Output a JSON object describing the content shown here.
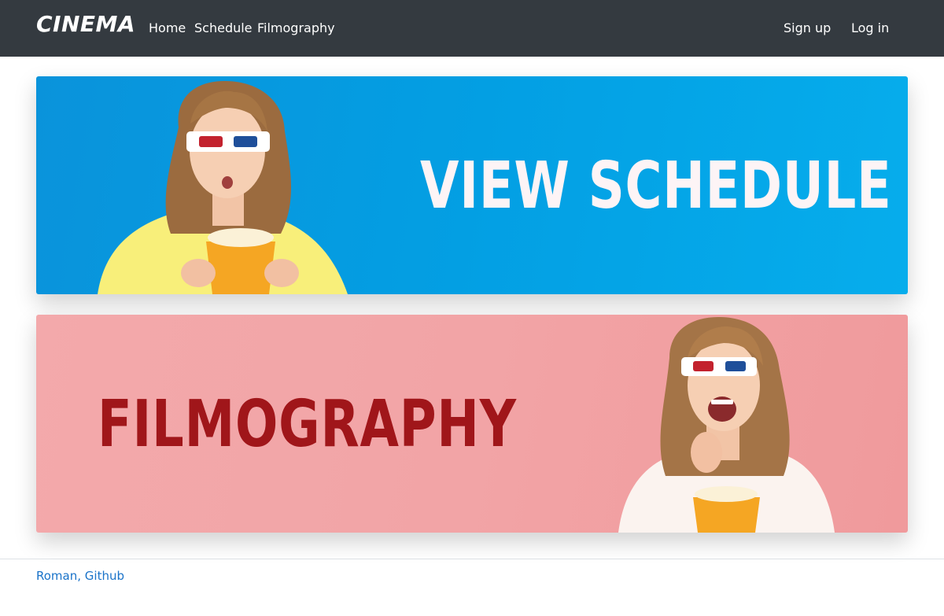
{
  "navbar": {
    "brand": "CINEMA",
    "links": [
      {
        "label": "Home"
      },
      {
        "label": "Schedule"
      },
      {
        "label": "Filmography"
      }
    ],
    "auth": [
      {
        "label": "Sign up"
      },
      {
        "label": "Log in"
      }
    ]
  },
  "banners": [
    {
      "title": "VIEW SCHEDULE",
      "background": "#039fe3",
      "text_color": "#fdf4f6"
    },
    {
      "title": "FILMOGRAPHY",
      "background": "#f2a4a6",
      "text_color": "#a0161a"
    }
  ],
  "footer": {
    "link": "Roman, Github"
  },
  "colors": {
    "navbar": "#343a40",
    "link": "#1a73c9"
  }
}
